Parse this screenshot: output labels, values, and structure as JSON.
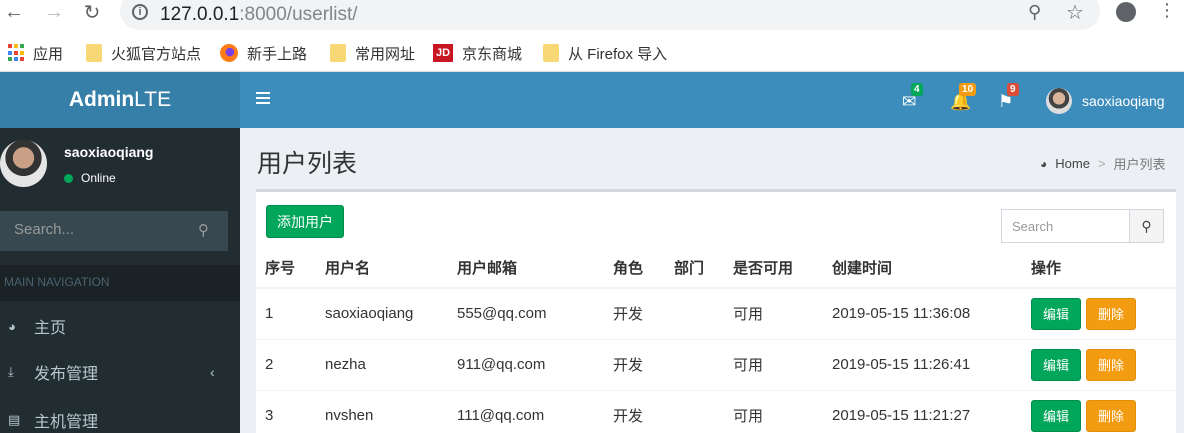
{
  "browser": {
    "url_host": "127.0.0.1",
    "url_port_path": ":8000/userlist/",
    "bookmarks": [
      {
        "label": "应用",
        "icon": "apps-grid-icon"
      },
      {
        "label": "火狐官方站点",
        "icon": "folder-icon"
      },
      {
        "label": "新手上路",
        "icon": "firefox-icon"
      },
      {
        "label": "常用网址",
        "icon": "folder-icon"
      },
      {
        "label": "京东商城",
        "icon": "jd-icon"
      },
      {
        "label": "从 Firefox 导入",
        "icon": "folder-icon"
      }
    ]
  },
  "header": {
    "logo_bold": "Admin",
    "logo_light": "LTE",
    "messages_count": "4",
    "notifications_count": "10",
    "tasks_count": "9",
    "user_name": "saoxiaoqiang",
    "colors": {
      "logo_bg": "#367fa9",
      "navbar_bg": "#3c8dbc"
    }
  },
  "sidebar": {
    "user_name": "saoxiaoqiang",
    "status": "Online",
    "search_placeholder": "Search...",
    "section_header": "MAIN NAVIGATION",
    "items": [
      {
        "label": "主页",
        "icon": "dashboard-icon"
      },
      {
        "label": "发布管理",
        "icon": "download-icon"
      },
      {
        "label": "主机管理",
        "icon": "server-icon"
      }
    ]
  },
  "page": {
    "title": "用户列表",
    "breadcrumb_home": "Home",
    "breadcrumb_sep": ">",
    "breadcrumb_current": "用户列表"
  },
  "toolbar": {
    "add_user_label": "添加用户",
    "search_placeholder": "Search"
  },
  "table": {
    "headers": [
      "序号",
      "用户名",
      "用户邮箱",
      "角色",
      "部门",
      "是否可用",
      "创建时间",
      "操作"
    ],
    "rows": [
      {
        "id": "1",
        "username": "saoxiaoqiang",
        "email": "555@qq.com",
        "role": "开发",
        "dept": "",
        "enabled": "可用",
        "created": "2019-05-15 11:36:08",
        "edit": "编辑",
        "delete": "删除"
      },
      {
        "id": "2",
        "username": "nezha",
        "email": "911@qq.com",
        "role": "开发",
        "dept": "",
        "enabled": "可用",
        "created": "2019-05-15 11:26:41",
        "edit": "编辑",
        "delete": "删除"
      },
      {
        "id": "3",
        "username": "nvshen",
        "email": "111@qq.com",
        "role": "开发",
        "dept": "",
        "enabled": "可用",
        "created": "2019-05-15 11:21:27",
        "edit": "编辑",
        "delete": "删除"
      }
    ]
  }
}
